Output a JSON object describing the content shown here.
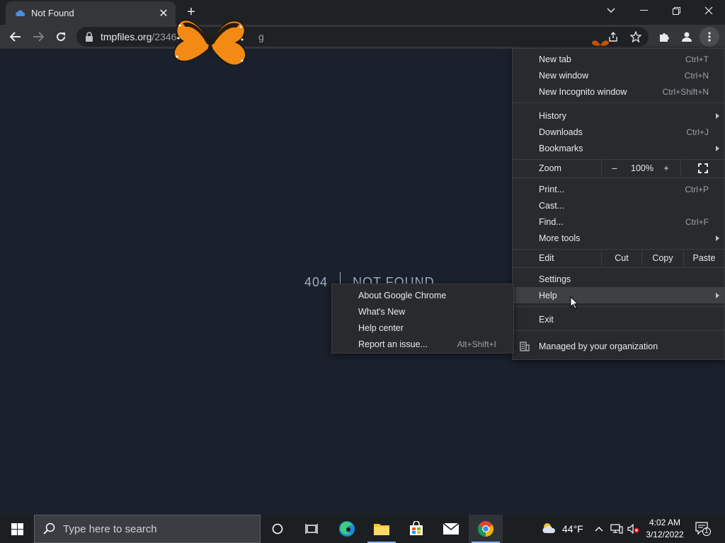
{
  "browser": {
    "tab": {
      "title": "Not Found"
    },
    "address": {
      "host": "tmpfiles.org",
      "path": "/234646",
      "tail": "g"
    }
  },
  "page": {
    "code": "404",
    "message": "NOT FOUND"
  },
  "menu": {
    "items": [
      {
        "label": "New tab",
        "shortcut": "Ctrl+T"
      },
      {
        "label": "New window",
        "shortcut": "Ctrl+N"
      },
      {
        "label": "New Incognito window",
        "shortcut": "Ctrl+Shift+N"
      },
      {
        "label": "History",
        "shortcut": ""
      },
      {
        "label": "Downloads",
        "shortcut": "Ctrl+J"
      },
      {
        "label": "Bookmarks",
        "shortcut": ""
      },
      {
        "label": "Print...",
        "shortcut": "Ctrl+P"
      },
      {
        "label": "Cast...",
        "shortcut": ""
      },
      {
        "label": "Find...",
        "shortcut": "Ctrl+F"
      },
      {
        "label": "More tools",
        "shortcut": ""
      },
      {
        "label": "Settings",
        "shortcut": ""
      },
      {
        "label": "Help",
        "shortcut": ""
      },
      {
        "label": "Exit",
        "shortcut": ""
      }
    ],
    "zoom": {
      "label": "Zoom",
      "minus": "–",
      "value": "100%",
      "plus": "+"
    },
    "edit": {
      "label": "Edit",
      "cut": "Cut",
      "copy": "Copy",
      "paste": "Paste"
    },
    "managed": "Managed by your organization"
  },
  "help_submenu": {
    "items": [
      {
        "label": "About Google Chrome",
        "shortcut": ""
      },
      {
        "label": "What's New",
        "shortcut": ""
      },
      {
        "label": "Help center",
        "shortcut": ""
      },
      {
        "label": "Report an issue...",
        "shortcut": "Alt+Shift+I"
      }
    ]
  },
  "taskbar": {
    "search_placeholder": "Type here to search",
    "weather": "44°F",
    "time": "4:02 AM",
    "date": "3/12/2022",
    "notification_count": "1"
  },
  "colors": {
    "page_bg": "#1a202c",
    "menu_bg": "#292a2d",
    "accent": "#8fb4ff"
  }
}
